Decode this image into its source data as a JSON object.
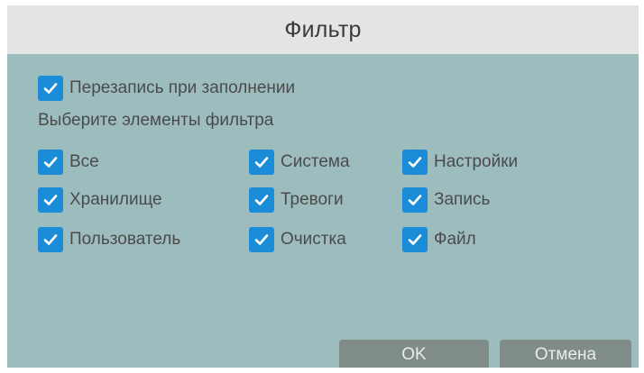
{
  "dialog": {
    "title": "Фильтр"
  },
  "overwrite": {
    "label": "Перезапись при заполнении",
    "checked": true
  },
  "filter": {
    "section_label": "Выберите элементы фильтра",
    "items": [
      {
        "label": "Все",
        "checked": true
      },
      {
        "label": "Система",
        "checked": true
      },
      {
        "label": "Настройки",
        "checked": true
      },
      {
        "label": "Хранилище",
        "checked": true
      },
      {
        "label": "Тревоги",
        "checked": true
      },
      {
        "label": "Запись",
        "checked": true
      },
      {
        "label": "Пользователь",
        "checked": true
      },
      {
        "label": "Очистка",
        "checked": true
      },
      {
        "label": "Файл",
        "checked": true
      }
    ]
  },
  "buttons": {
    "ok_label": "OK",
    "cancel_label": "Отмена"
  },
  "colors": {
    "dialog_background": "#9cbcbe",
    "titlebar_background": "#e4e4e4",
    "checkbox_fill": "#1a8cd8",
    "button_background": "#7f8c88"
  },
  "icons": {
    "checkbox_mark": "check-icon"
  }
}
